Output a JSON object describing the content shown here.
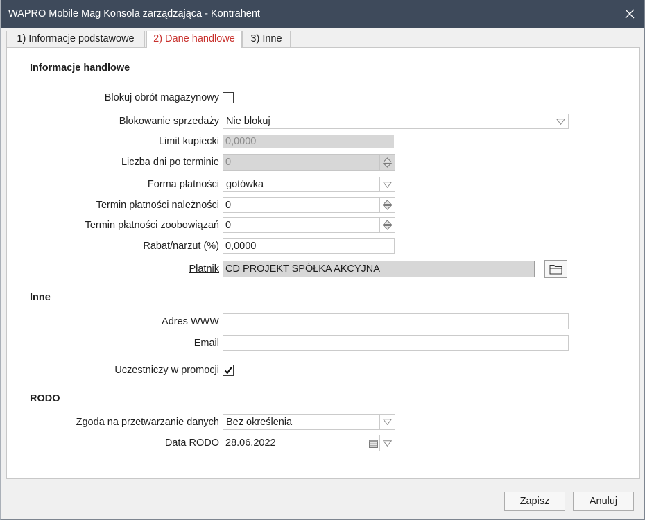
{
  "window": {
    "title": "WAPRO Mobile Mag Konsola zarządzająca - Kontrahent"
  },
  "colors": {
    "title_bar": "#3e4a5b",
    "active_tab_text": "#c8312d"
  },
  "icons": {
    "window_close": "close-icon",
    "dropdown": "dropdown-arrow-icon",
    "spinner": "spinner-arrows-icon",
    "browse": "folder-icon",
    "calendar": "calendar-icon",
    "checkbox_check": "checkmark-icon"
  },
  "tabs": [
    {
      "label": "1) Informacje podstawowe",
      "active": false
    },
    {
      "label": "2) Dane handlowe",
      "active": true
    },
    {
      "label": "3) Inne",
      "active": false
    }
  ],
  "sections": {
    "handlowe": {
      "title": "Informacje handlowe"
    },
    "inne": {
      "title": "Inne"
    },
    "rodo": {
      "title": "RODO"
    }
  },
  "fields": {
    "blokuj_obrot": {
      "label": "Blokuj obrót magazynowy",
      "checked": false
    },
    "blokowanie_sprzedazy": {
      "label": "Blokowanie sprzedaży",
      "value": "Nie blokuj"
    },
    "limit_kupiecki": {
      "label": "Limit kupiecki",
      "value": "0,0000",
      "disabled": true
    },
    "liczba_dni": {
      "label": "Liczba dni po terminie",
      "value": "0",
      "disabled": true
    },
    "forma_platnosci": {
      "label": "Forma płatności",
      "value": "gotówka"
    },
    "termin_naleznosci": {
      "label": "Termin płatności należności",
      "value": "0",
      "disabled": false
    },
    "termin_zobowiazan": {
      "label": "Termin płatności zoobowiązań",
      "value": "0",
      "disabled": false
    },
    "rabat": {
      "label": "Rabat/narzut (%)",
      "value": "0,0000"
    },
    "platnik": {
      "label": "Płatnik",
      "value": "CD PROJEKT SPÓŁKA AKCYJNA"
    },
    "adres_www": {
      "label": "Adres WWW",
      "value": ""
    },
    "email": {
      "label": "Email",
      "value": ""
    },
    "promocja": {
      "label": "Uczestniczy w promocji",
      "checked": true
    },
    "zgoda": {
      "label": "Zgoda na przetwarzanie danych",
      "value": "Bez określenia"
    },
    "data_rodo": {
      "label": "Data RODO",
      "value": "28.06.2022"
    }
  },
  "buttons": {
    "save": "Zapisz",
    "cancel": "Anuluj"
  }
}
